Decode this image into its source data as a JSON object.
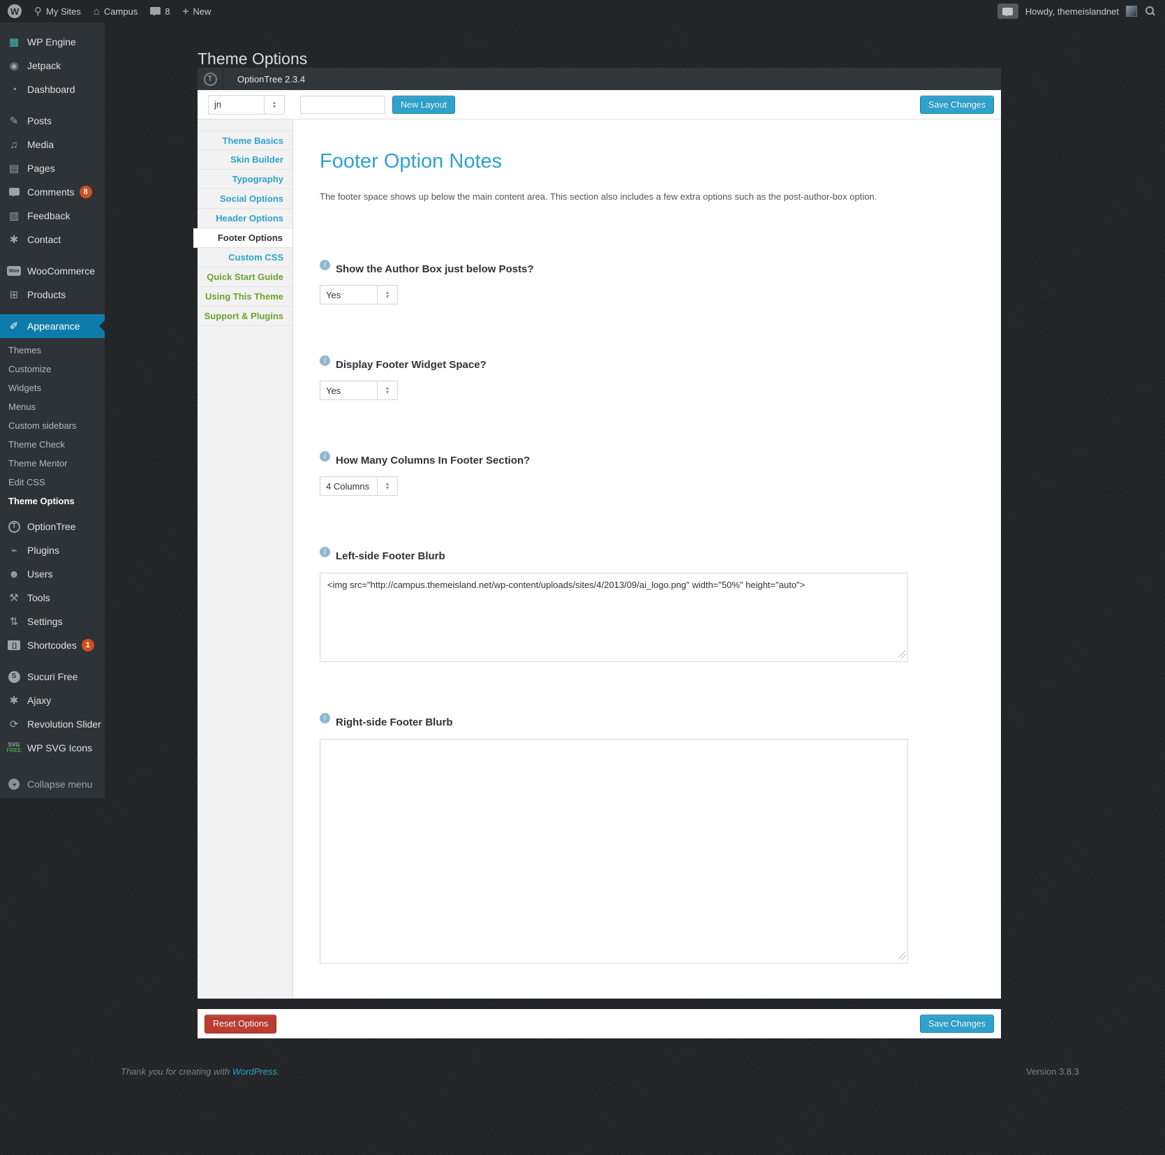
{
  "admin_bar": {
    "my_sites": "My Sites",
    "site_name": "Campus",
    "comments_count": "8",
    "new_label": "New",
    "howdy": "Howdy, themeislandnet"
  },
  "sidebar": {
    "items": [
      {
        "label": "WP Engine"
      },
      {
        "label": "Jetpack"
      },
      {
        "label": "Dashboard"
      },
      {
        "label": "Posts"
      },
      {
        "label": "Media"
      },
      {
        "label": "Pages"
      },
      {
        "label": "Comments",
        "badge": "8"
      },
      {
        "label": "Feedback"
      },
      {
        "label": "Contact"
      },
      {
        "label": "WooCommerce"
      },
      {
        "label": "Products"
      },
      {
        "label": "Appearance"
      },
      {
        "label": "OptionTree"
      },
      {
        "label": "Plugins"
      },
      {
        "label": "Users"
      },
      {
        "label": "Tools"
      },
      {
        "label": "Settings"
      },
      {
        "label": "Shortcodes",
        "badge": "1"
      },
      {
        "label": "Sucuri Free"
      },
      {
        "label": "Ajaxy"
      },
      {
        "label": "Revolution Slider"
      },
      {
        "label": "WP SVG Icons"
      },
      {
        "label": "Collapse menu"
      }
    ],
    "appearance_submenu": [
      {
        "label": "Themes"
      },
      {
        "label": "Customize"
      },
      {
        "label": "Widgets"
      },
      {
        "label": "Menus"
      },
      {
        "label": "Custom sidebars"
      },
      {
        "label": "Theme Check"
      },
      {
        "label": "Theme Mentor"
      },
      {
        "label": "Edit CSS"
      },
      {
        "label": "Theme Options"
      }
    ]
  },
  "page": {
    "title": "Theme Options"
  },
  "panel": {
    "header_title": "OptionTree 2.3.4",
    "toolbar": {
      "layout_select_value": "jn",
      "layout_input_value": "",
      "new_layout_label": "New Layout",
      "save_label": "Save Changes"
    },
    "tabs": [
      {
        "label": "Theme Basics"
      },
      {
        "label": "Skin Builder"
      },
      {
        "label": "Typography"
      },
      {
        "label": "Social Options"
      },
      {
        "label": "Header Options"
      },
      {
        "label": "Footer Options"
      },
      {
        "label": "Custom CSS"
      },
      {
        "label": "Quick Start Guide"
      },
      {
        "label": "Using This Theme"
      },
      {
        "label": "Support & Plugins"
      }
    ],
    "content": {
      "heading": "Footer Option Notes",
      "description": "The footer space shows up below the main content area. This section also includes a few extra options such as the post-author-box option.",
      "fields": [
        {
          "label": "Show the Author Box just below Posts?",
          "value": "Yes"
        },
        {
          "label": "Display Footer Widget Space?",
          "value": "Yes"
        },
        {
          "label": "How Many Columns In Footer Section?",
          "value": "4 Columns"
        },
        {
          "label": "Left-side Footer Blurb",
          "value": "<img src=\"http://campus.themeisland.net/wp-content/uploads/sites/4/2013/09/ai_logo.png\" width=\"50%\" height=\"auto\">"
        },
        {
          "label": "Right-side Footer Blurb",
          "value": ""
        }
      ]
    },
    "footer_actions": {
      "reset_label": "Reset Options",
      "save_label": "Save Changes"
    }
  },
  "footer": {
    "thanks_prefix": "Thank you for creating with ",
    "wordpress_link": "WordPress",
    "thanks_suffix": ".",
    "version": "Version 3.8.3"
  },
  "colors": {
    "accent_blue": "#2ea2cc",
    "menu_active_blue": "#0e7cab",
    "badge_red": "#d54e21",
    "reset_red": "#bb3d30",
    "tab_green": "#6ba32a"
  }
}
